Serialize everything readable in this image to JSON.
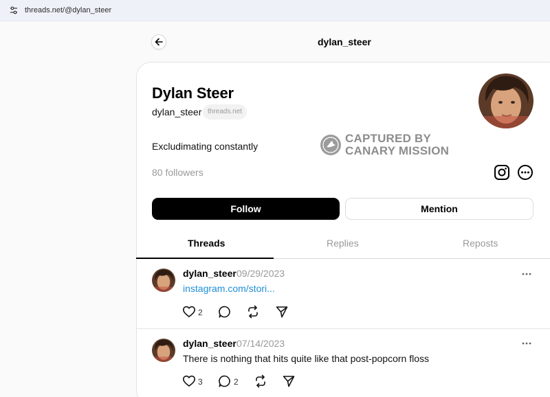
{
  "browser": {
    "url": "threads.net/@dylan_steer"
  },
  "header": {
    "title": "dylan_steer"
  },
  "profile": {
    "name": "Dylan Steer",
    "handle": "dylan_steer",
    "domain_badge": "threads.net",
    "bio": "Excludimating constantly",
    "followers": "80 followers"
  },
  "watermark": {
    "line1": "CAPTURED BY",
    "line2": "CANARY MISSION"
  },
  "buttons": {
    "follow": "Follow",
    "mention": "Mention"
  },
  "tabs": [
    {
      "label": "Threads",
      "active": true
    },
    {
      "label": "Replies",
      "active": false
    },
    {
      "label": "Reposts",
      "active": false
    }
  ],
  "posts": [
    {
      "user": "dylan_steer",
      "date": "09/29/2023",
      "link": "instagram.com/stori...",
      "likes": "2",
      "replies": ""
    },
    {
      "user": "dylan_steer",
      "date": "07/14/2023",
      "text": "There is nothing that hits quite like that post-popcorn floss",
      "likes": "3",
      "replies": "2"
    }
  ],
  "icons": {
    "back": "arrow-left-icon",
    "instagram": "instagram-icon",
    "more": "ellipsis-circle-icon",
    "like": "heart-icon",
    "reply": "comment-icon",
    "repost": "repost-icon",
    "share": "send-icon"
  },
  "colors": {
    "link": "#1e8ed6",
    "follow_bg": "#000000",
    "muted": "#999999"
  }
}
